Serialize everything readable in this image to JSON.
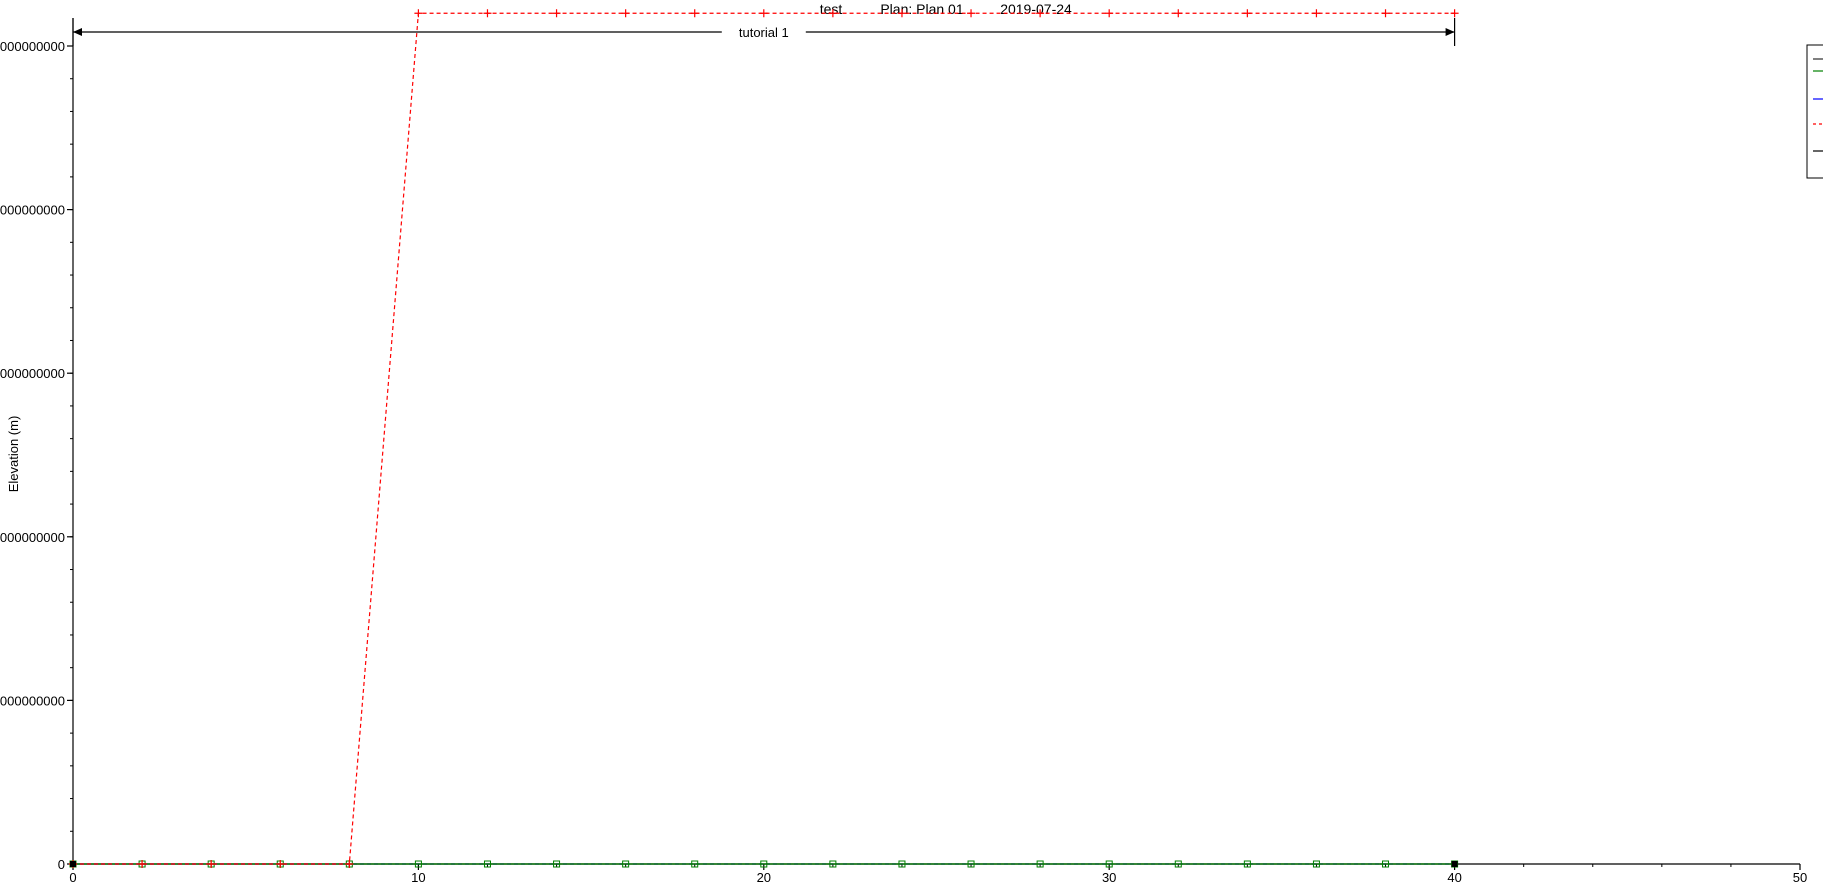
{
  "header": {
    "project": "test",
    "plan": "Plan: Plan 01",
    "date": "2019-07-24"
  },
  "reach": {
    "label": "tutorial 1",
    "start": 0,
    "end": 40
  },
  "colors": {
    "axis": "#000000",
    "red_series": "#ff0000",
    "green_series": "#008000",
    "blue_series": "#0000ff",
    "black_series": "#000000",
    "background": "#ffffff"
  },
  "chart_data": {
    "type": "line",
    "title": "",
    "xlabel": "",
    "ylabel": "Elevation (m)",
    "xlim": [
      0,
      50
    ],
    "ylim": [
      0,
      1000000000
    ],
    "x_ticks": [
      {
        "value": 0,
        "label": "0"
      },
      {
        "value": 10,
        "label": "10"
      },
      {
        "value": 20,
        "label": "20"
      },
      {
        "value": 30,
        "label": "30"
      },
      {
        "value": 40,
        "label": "40"
      },
      {
        "value": 50,
        "label": "50"
      }
    ],
    "y_ticks": [
      {
        "value": 0,
        "label": "0"
      },
      {
        "value": 200000000,
        "label": "000000000"
      },
      {
        "value": 400000000,
        "label": "000000000"
      },
      {
        "value": 600000000,
        "label": "000000000"
      },
      {
        "value": 800000000,
        "label": "000000000"
      },
      {
        "value": 1000000000,
        "label": "000000000"
      }
    ],
    "series": [
      {
        "color": "#ff0000",
        "dashed": true,
        "marker": "plus",
        "x": [
          0,
          2,
          4,
          6,
          8,
          10,
          12,
          14,
          16,
          18,
          20,
          22,
          24,
          26,
          28,
          30,
          32,
          34,
          36,
          38,
          40
        ],
        "y": [
          0,
          0,
          0,
          0,
          0,
          1040000000,
          1040000000,
          1040000000,
          1040000000,
          1040000000,
          1040000000,
          1040000000,
          1040000000,
          1040000000,
          1040000000,
          1040000000,
          1040000000,
          1040000000,
          1040000000,
          1040000000,
          1040000000
        ]
      },
      {
        "color": "#008000",
        "dashed": false,
        "marker": "square",
        "x": [
          0,
          2,
          4,
          6,
          8,
          10,
          12,
          14,
          16,
          18,
          20,
          22,
          24,
          26,
          28,
          30,
          32,
          34,
          36,
          38,
          40
        ],
        "y": [
          0,
          0,
          0,
          0,
          0,
          0,
          0,
          0,
          0,
          0,
          0,
          0,
          0,
          0,
          0,
          0,
          0,
          0,
          0,
          0,
          0
        ]
      },
      {
        "color": "#0000ff",
        "dashed": true,
        "marker": "none",
        "x": [
          0,
          40
        ],
        "y": [
          0,
          0
        ]
      },
      {
        "color": "#000000",
        "dashed": false,
        "marker": "none",
        "x": [
          0,
          40
        ],
        "y": [
          0,
          0
        ]
      }
    ],
    "grid": false,
    "legend_position": "top-right (clipped)"
  }
}
